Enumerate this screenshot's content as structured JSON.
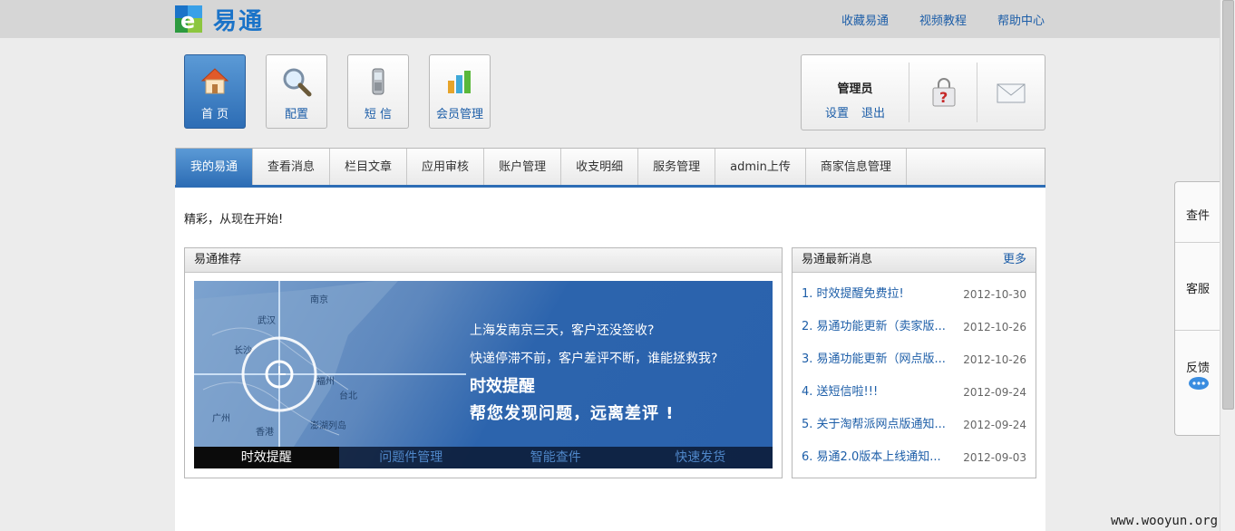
{
  "header": {
    "logo_text": "易通",
    "links": [
      "收藏易通",
      "视频教程",
      "帮助中心"
    ]
  },
  "toolbar": {
    "buttons": [
      {
        "label": "首 页",
        "icon": "home-icon",
        "active": true
      },
      {
        "label": "配置",
        "icon": "magnifier-icon"
      },
      {
        "label": "短 信",
        "icon": "phone-icon"
      },
      {
        "label": "会员管理",
        "icon": "bar-chart-icon"
      }
    ]
  },
  "user": {
    "name": "管理员",
    "settings_label": "设置",
    "logout_label": "退出",
    "help_icon": "question-bag-icon",
    "mail_icon": "envelope-icon"
  },
  "tabs": [
    "我的易通",
    "查看消息",
    "栏目文章",
    "应用审核",
    "账户管理",
    "收支明细",
    "服务管理",
    "admin上传",
    "商家信息管理"
  ],
  "main": {
    "slogan": "精彩，从现在开始!"
  },
  "recommend": {
    "title": "易通推荐",
    "banner": {
      "line1": "上海发南京三天，客户还没签收?",
      "line2": "快递停滞不前，客户差评不断，谁能拯救我?",
      "line3": "时效提醒",
      "line4": "帮您发现问题，远离差评 !",
      "map_labels": [
        "南京",
        "武汉",
        "长沙",
        "福州",
        "台北",
        "广州",
        "香港",
        "澎湖列岛"
      ],
      "tabs": [
        "时效提醒",
        "问题件管理",
        "智能查件",
        "快速发货"
      ]
    }
  },
  "news": {
    "title": "易通最新消息",
    "more": "更多",
    "items": [
      {
        "num": "1.",
        "title": "时效提醒免费拉!",
        "date": "2012-10-30"
      },
      {
        "num": "2.",
        "title": "易通功能更新（卖家版...",
        "date": "2012-10-26"
      },
      {
        "num": "3.",
        "title": "易通功能更新（网点版...",
        "date": "2012-10-26"
      },
      {
        "num": "4.",
        "title": "送短信啦!!!",
        "date": "2012-09-24"
      },
      {
        "num": "5.",
        "title": "关于淘帮派网点版通知...",
        "date": "2012-09-24"
      },
      {
        "num": "6.",
        "title": "易通2.0版本上线通知...",
        "date": "2012-09-03"
      }
    ]
  },
  "side": {
    "items": [
      "查件",
      "客服",
      "反馈"
    ]
  },
  "watermark": "www.wooyun.org"
}
